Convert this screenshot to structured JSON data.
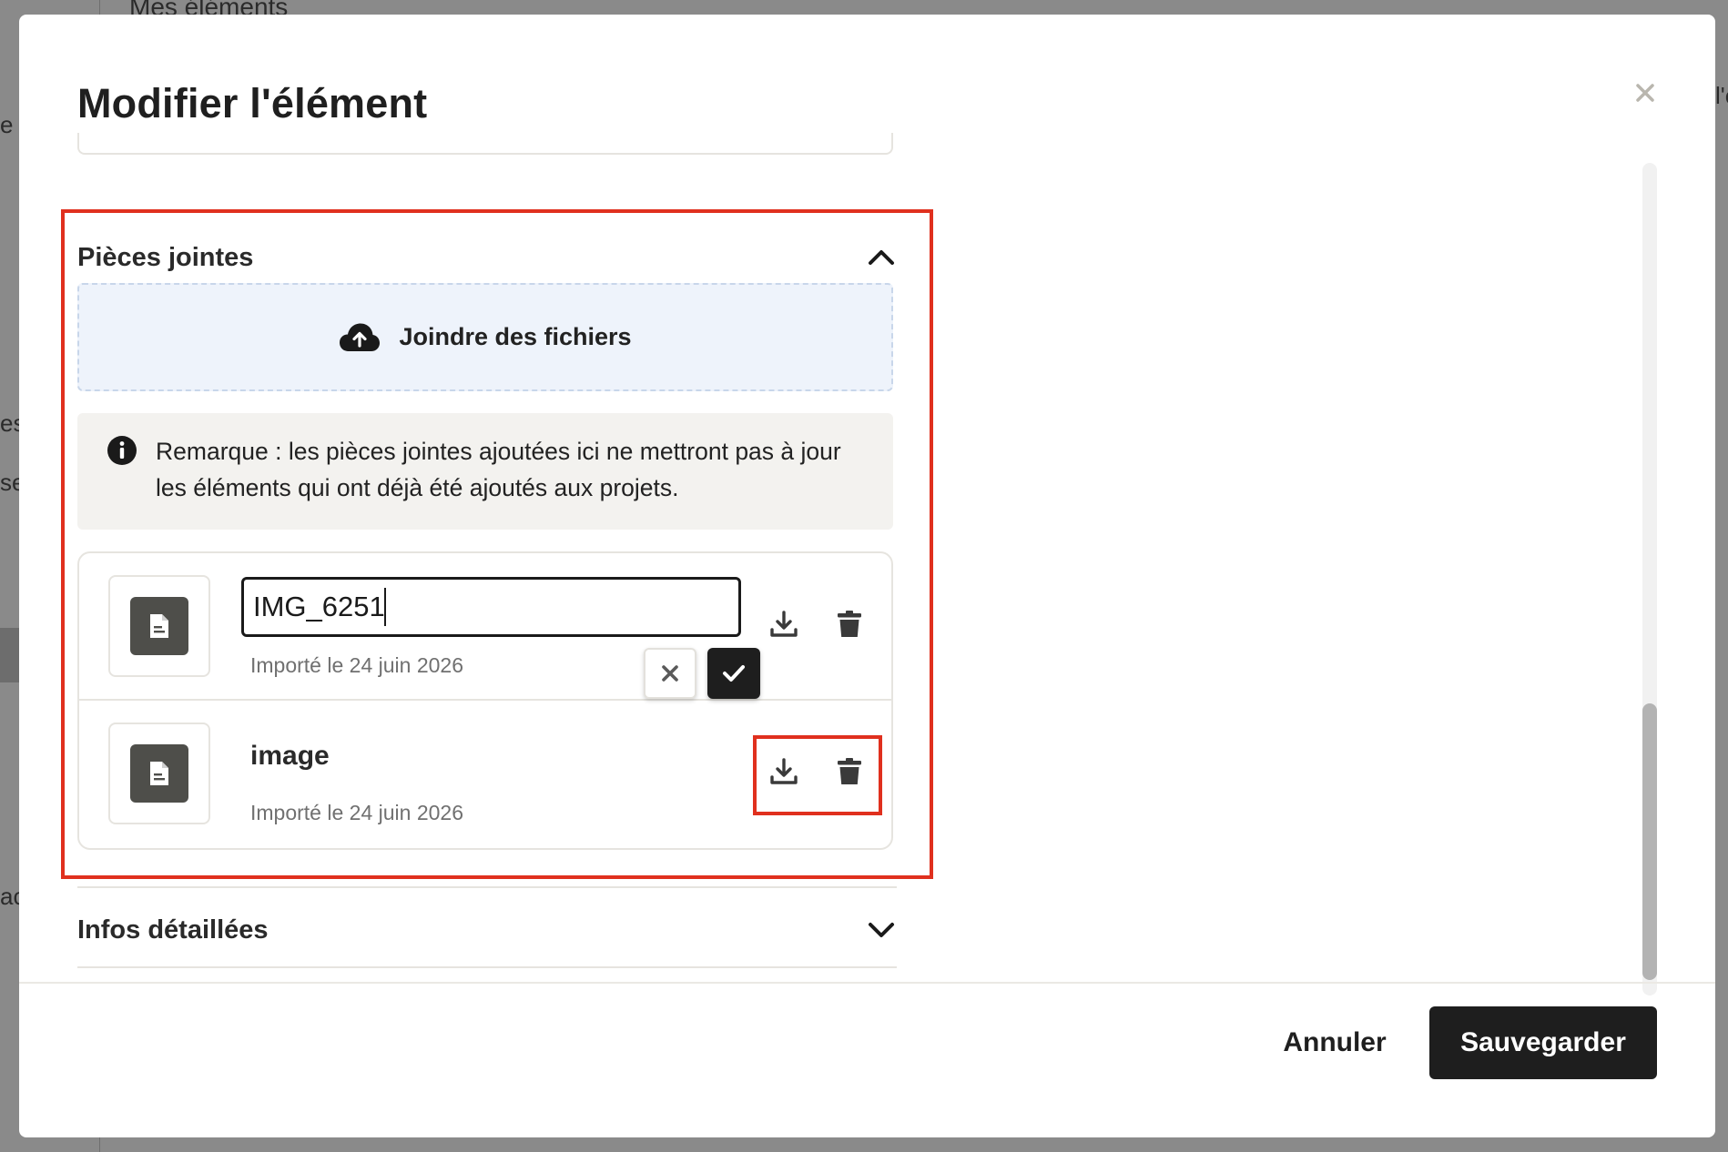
{
  "background": {
    "page_title": "Mes éléments",
    "fragments": [
      "e",
      "es",
      "se",
      "ac",
      "l'é"
    ]
  },
  "modal": {
    "title": "Modifier l'élément",
    "close_icon": "close-icon"
  },
  "attachments": {
    "title": "Pièces jointes",
    "toggle_icon": "chevron-up-icon",
    "drop_zone_label": "Joindre des fichiers",
    "drop_zone_icon": "cloud-upload-icon",
    "note_icon": "info-icon",
    "note": "Remarque : les pièces jointes ajoutées ici ne mettront pas à jour les éléments qui ont déjà été ajoutés aux projets.",
    "files": [
      {
        "name": "IMG_6251",
        "editing": true,
        "imported": "Importé le 24 juin 2026"
      },
      {
        "name": "image",
        "editing": false,
        "imported": "Importé le 24 juin 2026"
      }
    ]
  },
  "details": {
    "title": "Infos détaillées",
    "toggle_icon": "chevron-down-icon"
  },
  "footer": {
    "cancel_label": "Annuler",
    "save_label": "Sauvegarder"
  },
  "colors": {
    "highlight": "#e0301e",
    "primary": "#1e1e1e",
    "dropzone_bg": "#eef3fb",
    "note_bg": "#f3f2ef"
  }
}
